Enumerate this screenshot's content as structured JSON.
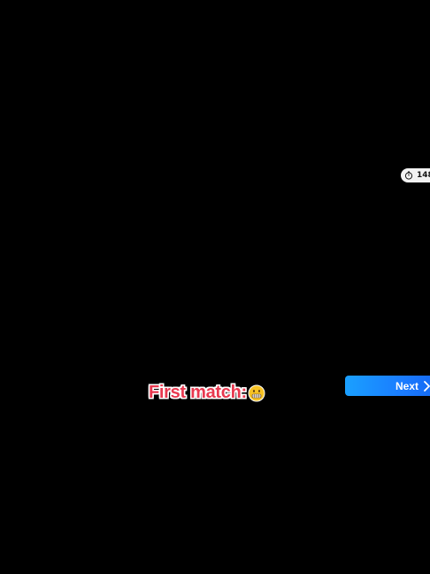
{
  "timer": {
    "value": "148",
    "icon": "stopwatch-icon"
  },
  "next_button": {
    "label": "Next",
    "icon": "chevron-right-icon"
  },
  "caption": {
    "text": "First match:",
    "emoji": "grimacing-face-icon"
  },
  "colors": {
    "background": "#000000",
    "caption_text": "#e8384f",
    "caption_outline": "#ffffff",
    "button_gradient_start": "#1aa0ff",
    "button_gradient_end": "#1466f0",
    "timer_pill": "#f2f2f2"
  }
}
